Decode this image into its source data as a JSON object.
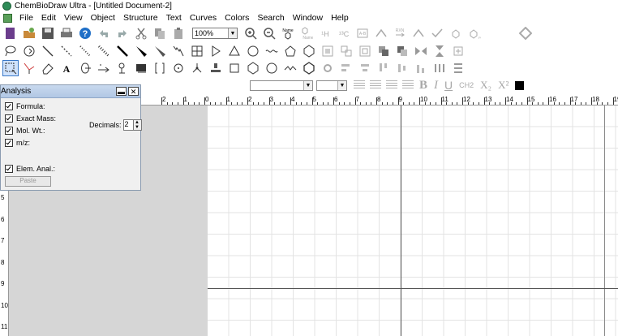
{
  "window": {
    "title": "ChemBioDraw Ultra - [Untitled Document-2]"
  },
  "menu": [
    "File",
    "Edit",
    "View",
    "Object",
    "Structure",
    "Text",
    "Curves",
    "Colors",
    "Search",
    "Window",
    "Help"
  ],
  "toolbar": {
    "zoom_value": "100%",
    "name_struct_label": "Name",
    "rxn_label": "RXN"
  },
  "toolbar_icons_row1": [
    "new-document-icon",
    "open-icon",
    "save-icon",
    "print-icon",
    "help-icon",
    "undo-icon",
    "redo-icon",
    "cut-icon",
    "copy-icon",
    "paste-icon"
  ],
  "toolbar_icons_row2": [
    "lasso-icon",
    "rotate-icon",
    "solid-bond-icon",
    "dashed-bond-icon",
    "hashed-bond-icon",
    "bold-hashed-bond-icon",
    "wedge-bond-icon",
    "hashed-wedge-bond-icon",
    "hollow-wedge-bond-icon",
    "wavy-bond-icon",
    "table-icon",
    "play-icon",
    "cyclopropane-icon",
    "cyclobutane-icon",
    "cyclopentane-icon",
    "cyclohexane-icon",
    "cycloheptane-icon",
    "cyclooctane-icon"
  ],
  "toolbar_icons_row3": [
    "marquee-icon",
    "eraser-icon",
    "text-icon",
    "orbital-icon",
    "arrow-icon",
    "chain-icon",
    "pen-icon",
    "bracket-icon",
    "charge-icon",
    "chem-symbols-icon",
    "stamp-icon",
    "rectangle-icon",
    "benzene-icon",
    "cyclohexane-chair-icon",
    "acyclic-chain-icon",
    "benzene-ring-icon"
  ],
  "format": {
    "subscript_label": "CH2",
    "x2_sub": "X₂",
    "x2_sup": "X²",
    "bold": "B",
    "italic": "I",
    "underline": "U"
  },
  "analysis_panel": {
    "title": "Analysis",
    "formula": "Formula:",
    "exact_mass": "Exact Mass:",
    "mol_wt": "Mol. Wt.:",
    "mz": "m/z:",
    "elem_anal": "Elem. Anal.:",
    "decimals_label": "Decimals:",
    "decimals_value": "2",
    "paste": "Paste"
  },
  "ruler": {
    "h_labels": [
      "2",
      "1",
      "0",
      "1",
      "2",
      "3",
      "4",
      "5",
      "6",
      "7",
      "8",
      "9",
      "10",
      "11",
      "12",
      "13",
      "14",
      "15",
      "16",
      "17",
      "18",
      "19"
    ],
    "v_labels": [
      "5",
      "6",
      "7",
      "8",
      "9",
      "10",
      "11"
    ]
  },
  "colors": {
    "selected_bg": "#cfe2fb",
    "panel_title": "#b1c7e4",
    "grid": "#e3e3e3"
  }
}
